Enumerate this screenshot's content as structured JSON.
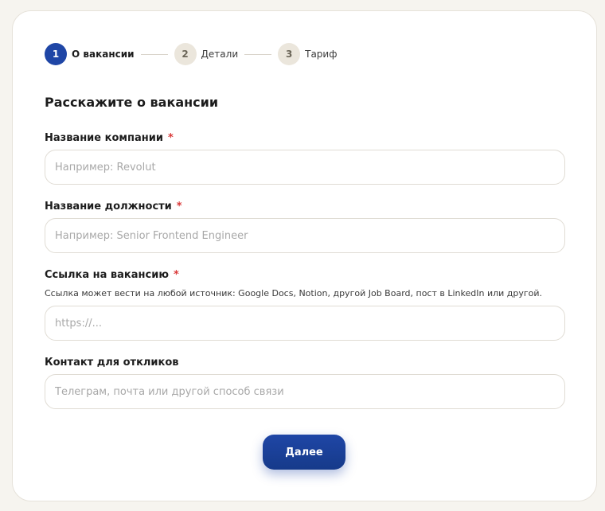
{
  "stepper": {
    "steps": [
      {
        "number": "1",
        "label": "О вакансии",
        "state": "active"
      },
      {
        "number": "2",
        "label": "Детали",
        "state": "inactive"
      },
      {
        "number": "3",
        "label": "Тариф",
        "state": "inactive"
      }
    ]
  },
  "form": {
    "title": "Расскажите о вакансии",
    "required_mark": "*",
    "company": {
      "label": "Название компании",
      "placeholder": "Например: Revolut",
      "value": ""
    },
    "position": {
      "label": "Название должности",
      "placeholder": "Например: Senior Frontend Engineer",
      "value": ""
    },
    "link": {
      "label": "Ссылка на вакансию",
      "hint": "Ссылка может вести на любой источник: Google Docs, Notion, другой Job Board, пост в LinkedIn или другой.",
      "placeholder": "https://...",
      "value": ""
    },
    "contact": {
      "label": "Контакт для откликов",
      "placeholder": "Телеграм, почта или другой способ связи",
      "value": ""
    },
    "next_label": "Далее"
  },
  "colors": {
    "accent": "#1f46a6",
    "required": "#d93838",
    "page_background": "#f6f4ef"
  }
}
